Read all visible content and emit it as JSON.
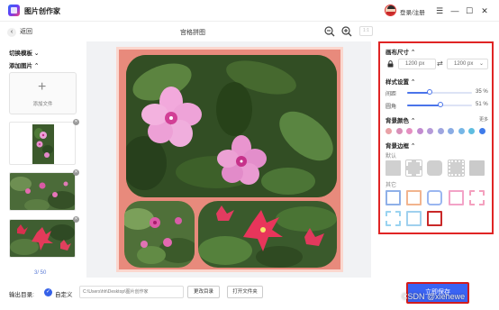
{
  "app": {
    "title": "图片创作家"
  },
  "header": {
    "login_label": "登录/注册",
    "window_controls": [
      "☰",
      "—",
      "☐",
      "✕"
    ]
  },
  "toolbar": {
    "back_label": "返回",
    "page_title": "宫格拼图",
    "ratio_label": "1:1"
  },
  "left_panel": {
    "switch_template_label": "切换模板",
    "add_image_label": "添加图片",
    "add_file_label": "添加文件",
    "page_counter": "3/ 50"
  },
  "bottom_bar": {
    "output_label": "输出目录:",
    "custom_label": "自定义",
    "path_placeholder": "C:\\Users\\hh\\Desktop\\图片创作家",
    "change_dir_label": "更改目录",
    "open_folder_label": "打开文件夹"
  },
  "right_panel": {
    "canvas_size_label": "画布尺寸",
    "width_value": "1200 px",
    "height_value": "1200 px",
    "style_label": "样式设置",
    "spacing_label": "间距",
    "spacing_value": "35 %",
    "spacing_percent": 0.35,
    "corner_label": "圆角",
    "corner_value": "51 %",
    "corner_percent": 0.51,
    "bg_color_label": "背景颜色",
    "more_label": "更多",
    "bg_colors": [
      "#e9a1a6",
      "#d88fb8",
      "#e58fc1",
      "#c28bd0",
      "#b59ad8",
      "#9ea5df",
      "#8aace4",
      "#76b6e6",
      "#5fbde0",
      "#3f7bea"
    ],
    "bg_border_label": "背景边框",
    "default_label": "默认",
    "other_label": "其它"
  },
  "actions": {
    "save_label": "立即保存"
  },
  "watermark": "CSDN @xiehewe"
}
